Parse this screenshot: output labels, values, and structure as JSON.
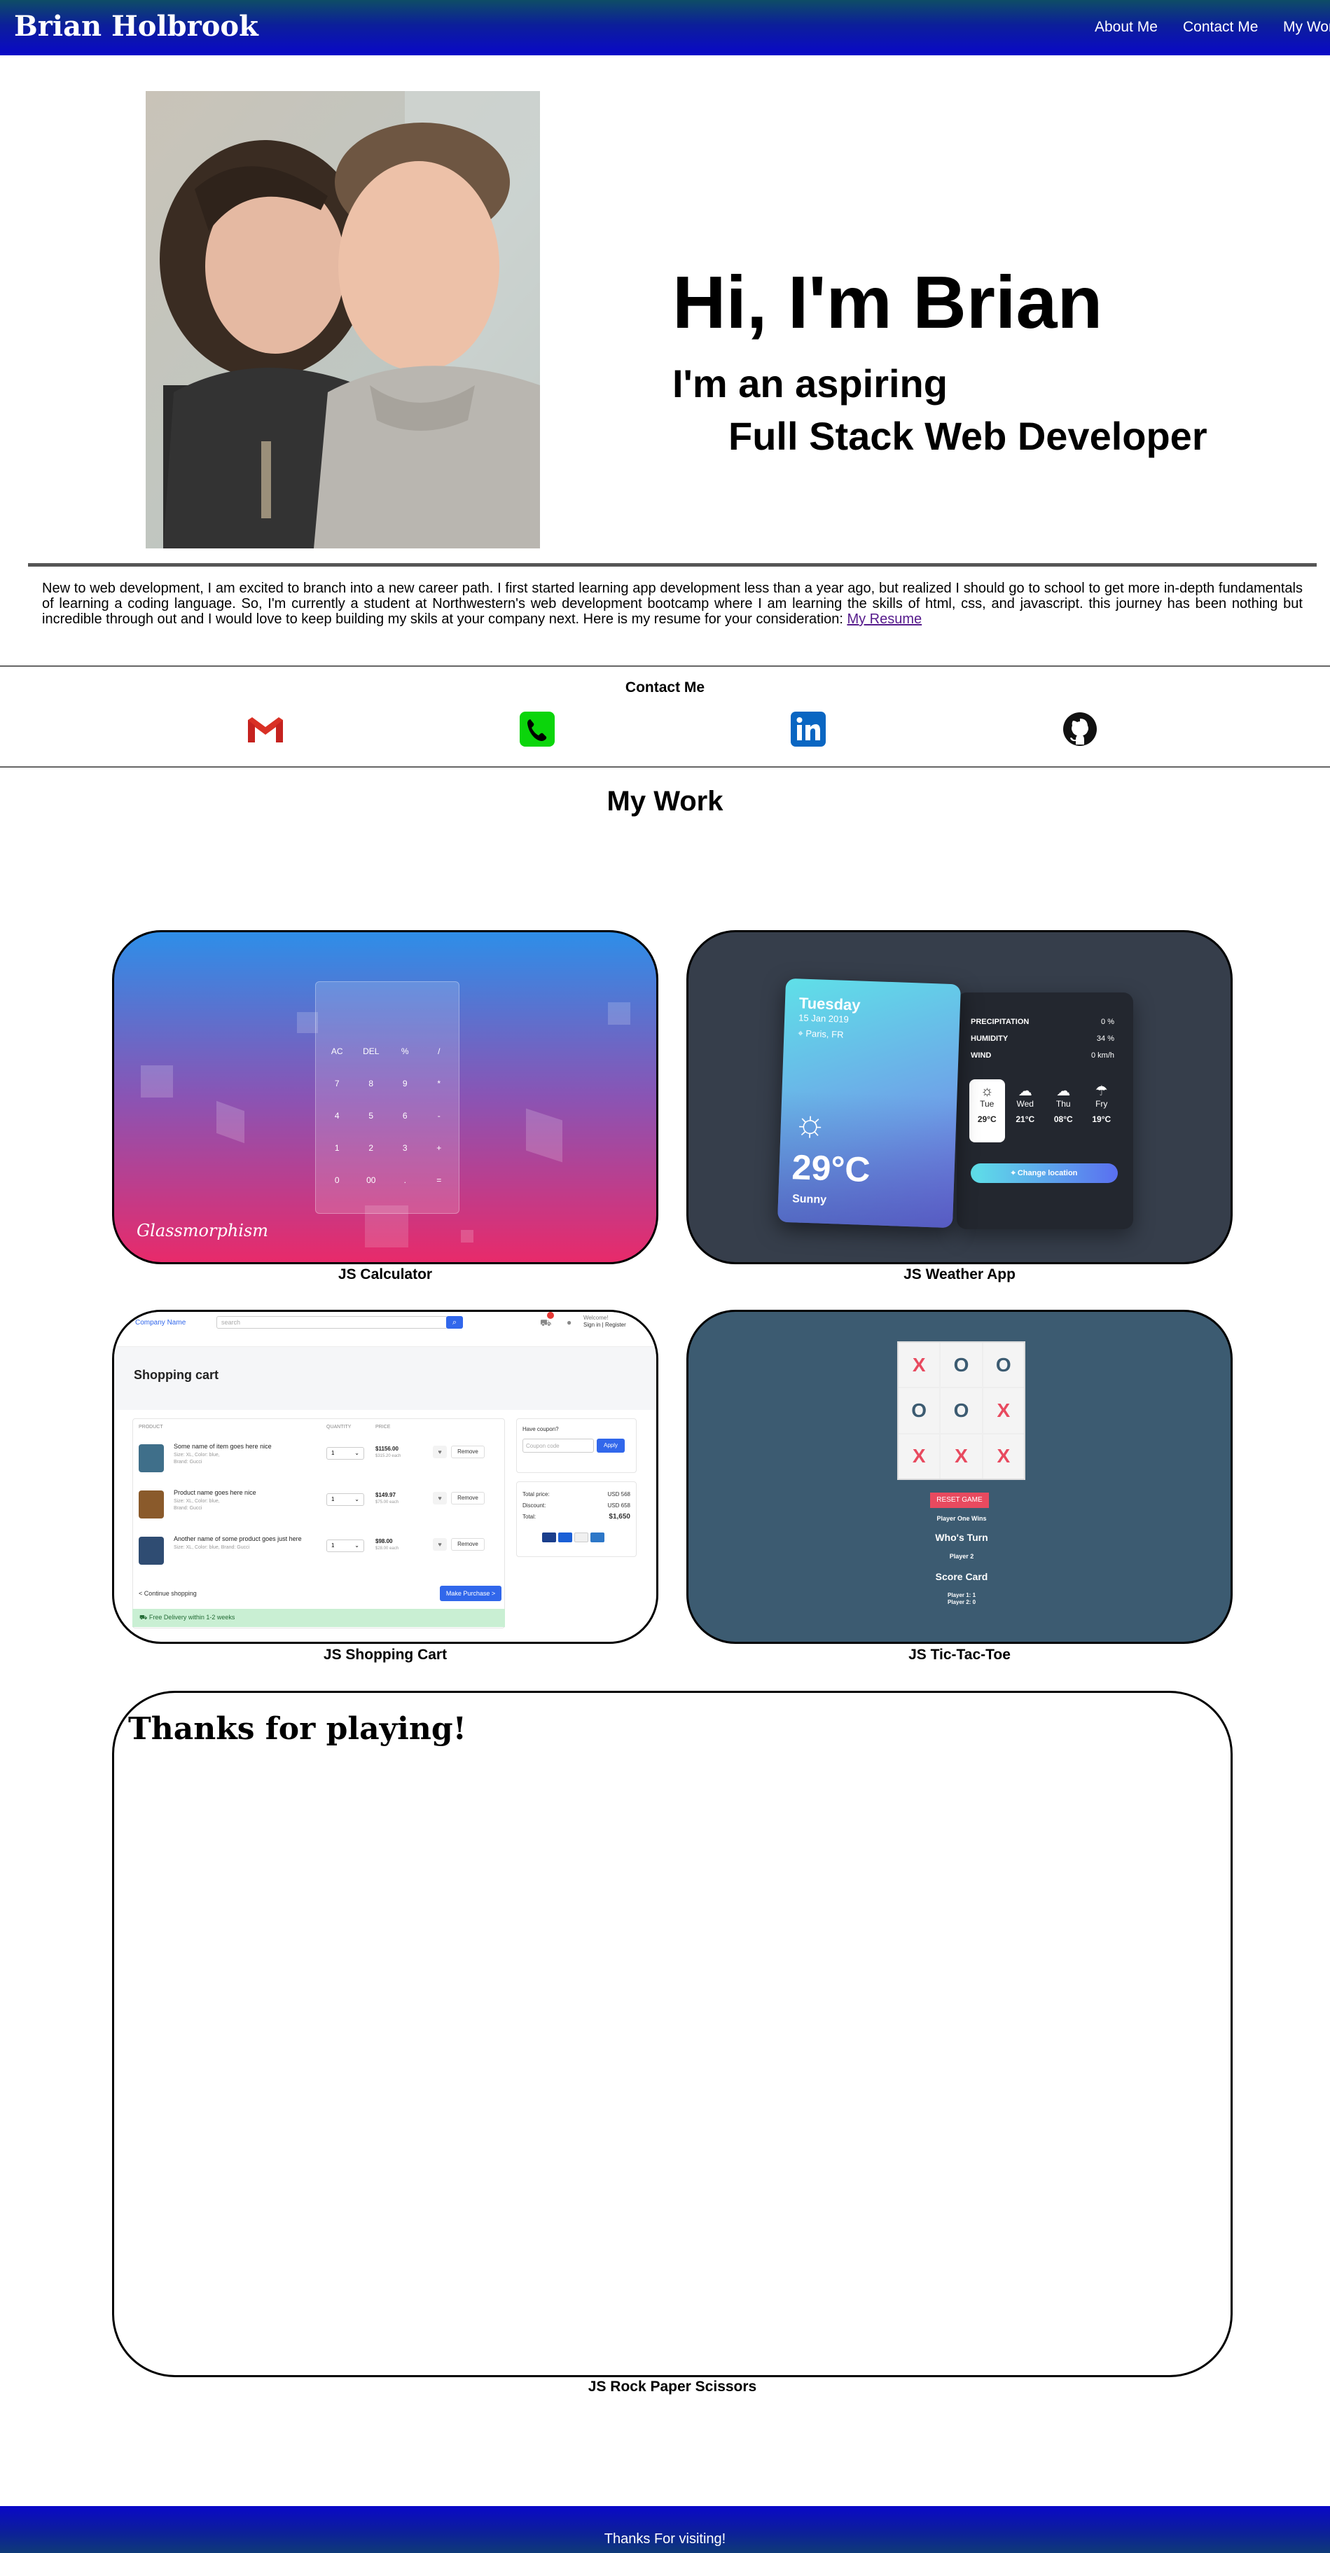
{
  "header": {
    "brand": "Brian Holbrook",
    "nav": [
      "About Me",
      "Contact Me",
      "My Work"
    ]
  },
  "hero": {
    "greeting": "Hi, I'm Brian",
    "line1": "I'm an aspiring",
    "line2": "Full Stack Web Developer"
  },
  "intro": {
    "text": "New to web development, I am excited to branch into a new career path. I first started learning app development less than a year ago, but realized I should go to school to get more in-depth fundamentals of learning a coding language. So, I'm currently a student at Northwestern's web development bootcamp where I am learning the skills of html, css, and javascript. this journey has been nothing but incredible through out and I would love to keep building my skils at your company next. Here is my resume for your consideration: ",
    "resume_link": "My Resume"
  },
  "contact": {
    "title": "Contact Me",
    "icons": [
      "gmail-icon",
      "phone-icon",
      "linkedin-icon",
      "github-icon"
    ]
  },
  "work": {
    "title": "My Work",
    "projects": [
      {
        "caption": "JS Calculator"
      },
      {
        "caption": "JS Weather App"
      },
      {
        "caption": "JS Shopping Cart"
      },
      {
        "caption": "JS Tic-Tac-Toe"
      },
      {
        "caption": "JS Rock Paper Scissors"
      }
    ]
  },
  "calculator": {
    "keys": [
      "AC",
      "DEL",
      "%",
      "/",
      "7",
      "8",
      "9",
      "*",
      "4",
      "5",
      "6",
      "-",
      "1",
      "2",
      "3",
      "+",
      "0",
      "00",
      ".",
      "="
    ],
    "brand": "Glassmorphism"
  },
  "weather": {
    "day": "Tuesday",
    "date": "15 Jan 2019",
    "location": "Paris, FR",
    "temp": "29°C",
    "condition": "Sunny",
    "stats": [
      {
        "label": "PRECIPITATION",
        "value": "0 %"
      },
      {
        "label": "HUMIDITY",
        "value": "34 %"
      },
      {
        "label": "WIND",
        "value": "0 km/h"
      }
    ],
    "days": [
      {
        "name": "Tue",
        "temp": "29°C"
      },
      {
        "name": "Wed",
        "temp": "21°C"
      },
      {
        "name": "Thu",
        "temp": "08°C"
      },
      {
        "name": "Fry",
        "temp": "19°C"
      }
    ],
    "button": "Change location"
  },
  "cart": {
    "company": "Company Name",
    "search_placeholder": "search",
    "account_line1": "Welcome!",
    "account_line2": "Sign in | Register",
    "title": "Shopping cart",
    "headers": [
      "PRODUCT",
      "QUANTITY",
      "PRICE"
    ],
    "items": [
      {
        "name": "Some name of item goes here nice",
        "meta1": "Size: XL, Color: blue,",
        "meta2": "Brand: Gucci",
        "qty": "1",
        "price": "$1156.00",
        "each": "$315.20 each",
        "remove": "Remove"
      },
      {
        "name": "Product name goes here nice",
        "meta1": "Size: XL, Color: blue,",
        "meta2": "Brand: Gucci",
        "qty": "1",
        "price": "$149.97",
        "each": "$75.00 each",
        "remove": "Remove"
      },
      {
        "name": "Another name of some product goes just here",
        "meta1": "Size: XL, Color: blue, Brand: Gucci",
        "meta2": "",
        "qty": "1",
        "price": "$98.00",
        "each": "$28.00 each",
        "remove": "Remove"
      }
    ],
    "continue": "< Continue shopping",
    "purchase": "Make Purchase >",
    "delivery": "Free Delivery within 1-2 weeks",
    "coupon_title": "Have coupon?",
    "coupon_placeholder": "Coupon code",
    "apply": "Apply",
    "totals": [
      {
        "label": "Total price:",
        "value": "USD 568"
      },
      {
        "label": "Discount:",
        "value": "USD 658"
      },
      {
        "label": "Total:",
        "value": "$1,650"
      }
    ]
  },
  "tictactoe": {
    "board": [
      "X",
      "O",
      "O",
      "O",
      "O",
      "X",
      "X",
      "X",
      "X"
    ],
    "reset": "RESET GAME",
    "winner": "Player One Wins",
    "turn_title": "Who's Turn",
    "turn_player": "Player 2",
    "score_title": "Score Card",
    "score1": "Player 1: 1",
    "score2": "Player 2: 0"
  },
  "rps": {
    "title": "Thanks for playing!"
  },
  "footer": {
    "text": "Thanks For visiting!"
  },
  "colors": {
    "header_blue": "#0a08c8",
    "link": "#551a8b",
    "ttt_x": "#e84a5f",
    "ttt_o": "#3c5b71"
  }
}
